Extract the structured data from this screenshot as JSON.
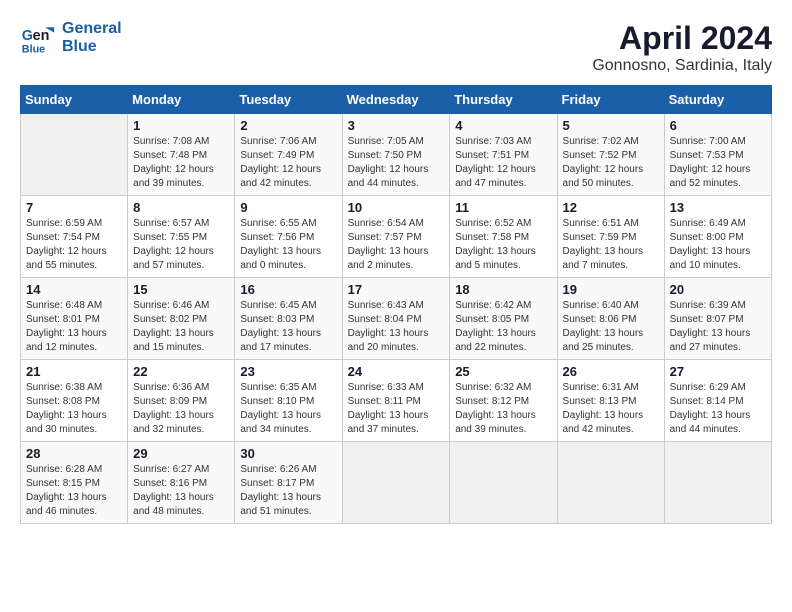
{
  "logo": {
    "line1": "General",
    "line2": "Blue"
  },
  "title": "April 2024",
  "subtitle": "Gonnosno, Sardinia, Italy",
  "days_of_week": [
    "Sunday",
    "Monday",
    "Tuesday",
    "Wednesday",
    "Thursday",
    "Friday",
    "Saturday"
  ],
  "weeks": [
    [
      {
        "day": "",
        "sunrise": "",
        "sunset": "",
        "daylight": ""
      },
      {
        "day": "1",
        "sunrise": "Sunrise: 7:08 AM",
        "sunset": "Sunset: 7:48 PM",
        "daylight": "Daylight: 12 hours and 39 minutes."
      },
      {
        "day": "2",
        "sunrise": "Sunrise: 7:06 AM",
        "sunset": "Sunset: 7:49 PM",
        "daylight": "Daylight: 12 hours and 42 minutes."
      },
      {
        "day": "3",
        "sunrise": "Sunrise: 7:05 AM",
        "sunset": "Sunset: 7:50 PM",
        "daylight": "Daylight: 12 hours and 44 minutes."
      },
      {
        "day": "4",
        "sunrise": "Sunrise: 7:03 AM",
        "sunset": "Sunset: 7:51 PM",
        "daylight": "Daylight: 12 hours and 47 minutes."
      },
      {
        "day": "5",
        "sunrise": "Sunrise: 7:02 AM",
        "sunset": "Sunset: 7:52 PM",
        "daylight": "Daylight: 12 hours and 50 minutes."
      },
      {
        "day": "6",
        "sunrise": "Sunrise: 7:00 AM",
        "sunset": "Sunset: 7:53 PM",
        "daylight": "Daylight: 12 hours and 52 minutes."
      }
    ],
    [
      {
        "day": "7",
        "sunrise": "Sunrise: 6:59 AM",
        "sunset": "Sunset: 7:54 PM",
        "daylight": "Daylight: 12 hours and 55 minutes."
      },
      {
        "day": "8",
        "sunrise": "Sunrise: 6:57 AM",
        "sunset": "Sunset: 7:55 PM",
        "daylight": "Daylight: 12 hours and 57 minutes."
      },
      {
        "day": "9",
        "sunrise": "Sunrise: 6:55 AM",
        "sunset": "Sunset: 7:56 PM",
        "daylight": "Daylight: 13 hours and 0 minutes."
      },
      {
        "day": "10",
        "sunrise": "Sunrise: 6:54 AM",
        "sunset": "Sunset: 7:57 PM",
        "daylight": "Daylight: 13 hours and 2 minutes."
      },
      {
        "day": "11",
        "sunrise": "Sunrise: 6:52 AM",
        "sunset": "Sunset: 7:58 PM",
        "daylight": "Daylight: 13 hours and 5 minutes."
      },
      {
        "day": "12",
        "sunrise": "Sunrise: 6:51 AM",
        "sunset": "Sunset: 7:59 PM",
        "daylight": "Daylight: 13 hours and 7 minutes."
      },
      {
        "day": "13",
        "sunrise": "Sunrise: 6:49 AM",
        "sunset": "Sunset: 8:00 PM",
        "daylight": "Daylight: 13 hours and 10 minutes."
      }
    ],
    [
      {
        "day": "14",
        "sunrise": "Sunrise: 6:48 AM",
        "sunset": "Sunset: 8:01 PM",
        "daylight": "Daylight: 13 hours and 12 minutes."
      },
      {
        "day": "15",
        "sunrise": "Sunrise: 6:46 AM",
        "sunset": "Sunset: 8:02 PM",
        "daylight": "Daylight: 13 hours and 15 minutes."
      },
      {
        "day": "16",
        "sunrise": "Sunrise: 6:45 AM",
        "sunset": "Sunset: 8:03 PM",
        "daylight": "Daylight: 13 hours and 17 minutes."
      },
      {
        "day": "17",
        "sunrise": "Sunrise: 6:43 AM",
        "sunset": "Sunset: 8:04 PM",
        "daylight": "Daylight: 13 hours and 20 minutes."
      },
      {
        "day": "18",
        "sunrise": "Sunrise: 6:42 AM",
        "sunset": "Sunset: 8:05 PM",
        "daylight": "Daylight: 13 hours and 22 minutes."
      },
      {
        "day": "19",
        "sunrise": "Sunrise: 6:40 AM",
        "sunset": "Sunset: 8:06 PM",
        "daylight": "Daylight: 13 hours and 25 minutes."
      },
      {
        "day": "20",
        "sunrise": "Sunrise: 6:39 AM",
        "sunset": "Sunset: 8:07 PM",
        "daylight": "Daylight: 13 hours and 27 minutes."
      }
    ],
    [
      {
        "day": "21",
        "sunrise": "Sunrise: 6:38 AM",
        "sunset": "Sunset: 8:08 PM",
        "daylight": "Daylight: 13 hours and 30 minutes."
      },
      {
        "day": "22",
        "sunrise": "Sunrise: 6:36 AM",
        "sunset": "Sunset: 8:09 PM",
        "daylight": "Daylight: 13 hours and 32 minutes."
      },
      {
        "day": "23",
        "sunrise": "Sunrise: 6:35 AM",
        "sunset": "Sunset: 8:10 PM",
        "daylight": "Daylight: 13 hours and 34 minutes."
      },
      {
        "day": "24",
        "sunrise": "Sunrise: 6:33 AM",
        "sunset": "Sunset: 8:11 PM",
        "daylight": "Daylight: 13 hours and 37 minutes."
      },
      {
        "day": "25",
        "sunrise": "Sunrise: 6:32 AM",
        "sunset": "Sunset: 8:12 PM",
        "daylight": "Daylight: 13 hours and 39 minutes."
      },
      {
        "day": "26",
        "sunrise": "Sunrise: 6:31 AM",
        "sunset": "Sunset: 8:13 PM",
        "daylight": "Daylight: 13 hours and 42 minutes."
      },
      {
        "day": "27",
        "sunrise": "Sunrise: 6:29 AM",
        "sunset": "Sunset: 8:14 PM",
        "daylight": "Daylight: 13 hours and 44 minutes."
      }
    ],
    [
      {
        "day": "28",
        "sunrise": "Sunrise: 6:28 AM",
        "sunset": "Sunset: 8:15 PM",
        "daylight": "Daylight: 13 hours and 46 minutes."
      },
      {
        "day": "29",
        "sunrise": "Sunrise: 6:27 AM",
        "sunset": "Sunset: 8:16 PM",
        "daylight": "Daylight: 13 hours and 48 minutes."
      },
      {
        "day": "30",
        "sunrise": "Sunrise: 6:26 AM",
        "sunset": "Sunset: 8:17 PM",
        "daylight": "Daylight: 13 hours and 51 minutes."
      },
      {
        "day": "",
        "sunrise": "",
        "sunset": "",
        "daylight": ""
      },
      {
        "day": "",
        "sunrise": "",
        "sunset": "",
        "daylight": ""
      },
      {
        "day": "",
        "sunrise": "",
        "sunset": "",
        "daylight": ""
      },
      {
        "day": "",
        "sunrise": "",
        "sunset": "",
        "daylight": ""
      }
    ]
  ]
}
